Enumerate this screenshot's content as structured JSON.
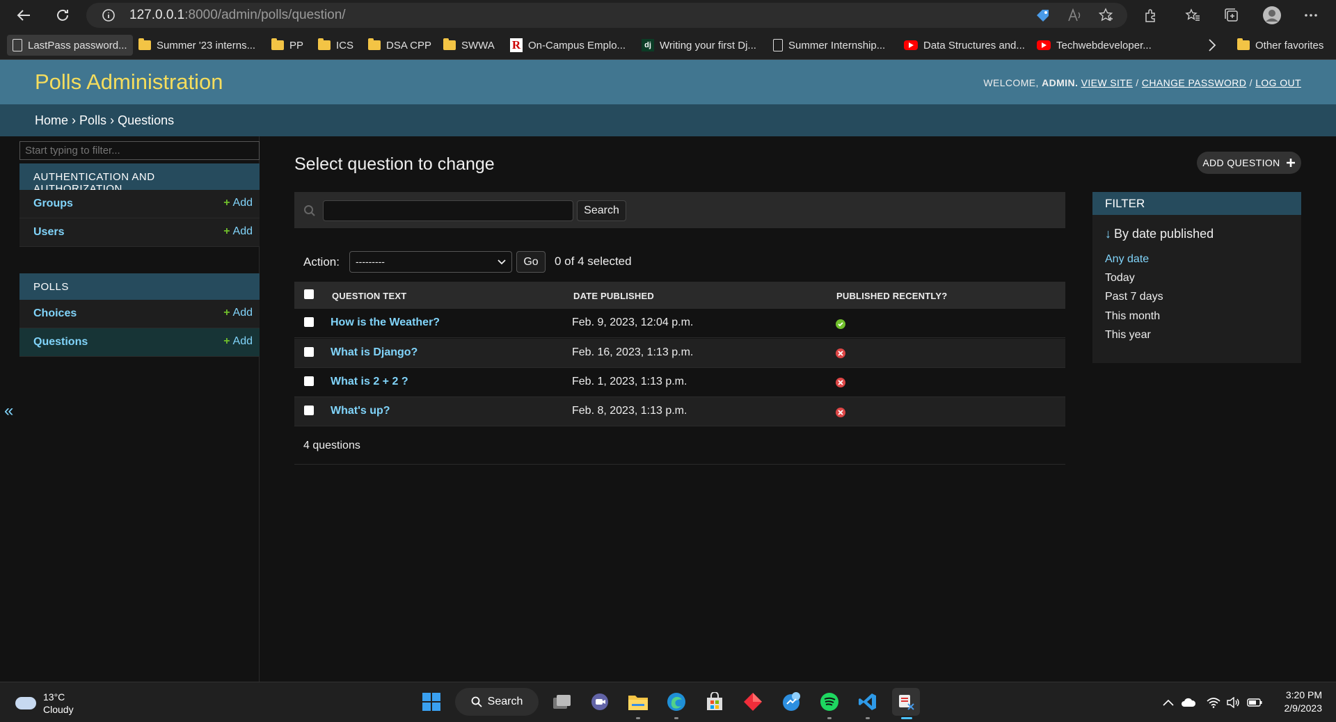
{
  "browser": {
    "url_host": "127.0.0.1",
    "url_path": ":8000/admin/polls/question/",
    "bookmarks": [
      {
        "label": "LastPass password...",
        "icon": "page-icon"
      },
      {
        "label": "Summer '23 interns...",
        "icon": "folder-icon"
      },
      {
        "label": "PP",
        "icon": "folder-icon"
      },
      {
        "label": "ICS",
        "icon": "folder-icon"
      },
      {
        "label": "DSA CPP",
        "icon": "folder-icon"
      },
      {
        "label": "SWWA",
        "icon": "folder-icon"
      },
      {
        "label": "On-Campus Emplo...",
        "icon": "r-logo-icon"
      },
      {
        "label": "Writing your first Dj...",
        "icon": "django-icon"
      },
      {
        "label": "Summer Internship...",
        "icon": "page-icon"
      },
      {
        "label": "Data Structures and...",
        "icon": "youtube-icon"
      },
      {
        "label": "Techwebdeveloper...",
        "icon": "youtube-icon"
      }
    ],
    "other_favorites": "Other favorites"
  },
  "header": {
    "brand": "Polls Administration",
    "welcome": "WELCOME,",
    "user": "ADMIN.",
    "view_site": "VIEW SITE",
    "change_password": "CHANGE PASSWORD",
    "log_out": "LOG OUT",
    "sep": "/"
  },
  "breadcrumbs": {
    "home": "Home",
    "app": "Polls",
    "model": "Questions",
    "sep": "›"
  },
  "sidebar": {
    "filter_placeholder": "Start typing to filter...",
    "auth_caption": "AUTHENTICATION AND AUTHORIZATION",
    "polls_caption": "POLLS",
    "add_label": "Add",
    "auth_models": [
      "Groups",
      "Users"
    ],
    "polls_models": [
      "Choices",
      "Questions"
    ],
    "collapse": "«"
  },
  "content": {
    "title": "Select question to change",
    "add_button": "ADD QUESTION",
    "search_button": "Search",
    "action_label": "Action:",
    "action_selected": "---------",
    "go_button": "Go",
    "counter": "0 of 4 selected",
    "columns": [
      "QUESTION TEXT",
      "DATE PUBLISHED",
      "PUBLISHED RECENTLY?"
    ],
    "rows": [
      {
        "question": "How is the Weather?",
        "date": "Feb. 9, 2023, 12:04 p.m.",
        "recent": true
      },
      {
        "question": "What is Django?",
        "date": "Feb. 16, 2023, 1:13 p.m.",
        "recent": false
      },
      {
        "question": "What is 2 + 2 ?",
        "date": "Feb. 1, 2023, 1:13 p.m.",
        "recent": false
      },
      {
        "question": "What's up?",
        "date": "Feb. 8, 2023, 1:13 p.m.",
        "recent": false
      }
    ],
    "paginator": "4 questions"
  },
  "filter": {
    "caption": "FILTER",
    "heading_arrow": "↓",
    "heading": "By date published",
    "options": [
      "Any date",
      "Today",
      "Past 7 days",
      "This month",
      "This year"
    ],
    "selected": "Any date"
  },
  "taskbar": {
    "temp": "13°C",
    "condition": "Cloudy",
    "search": "Search",
    "time": "3:20 PM",
    "date": "2/9/2023"
  },
  "colors": {
    "header_bg": "#417690",
    "brand": "#f5dd5d",
    "link": "#81d4fa",
    "caption_bg": "#264b5d",
    "add_plus": "#70bf2b",
    "error": "#dd4646"
  }
}
